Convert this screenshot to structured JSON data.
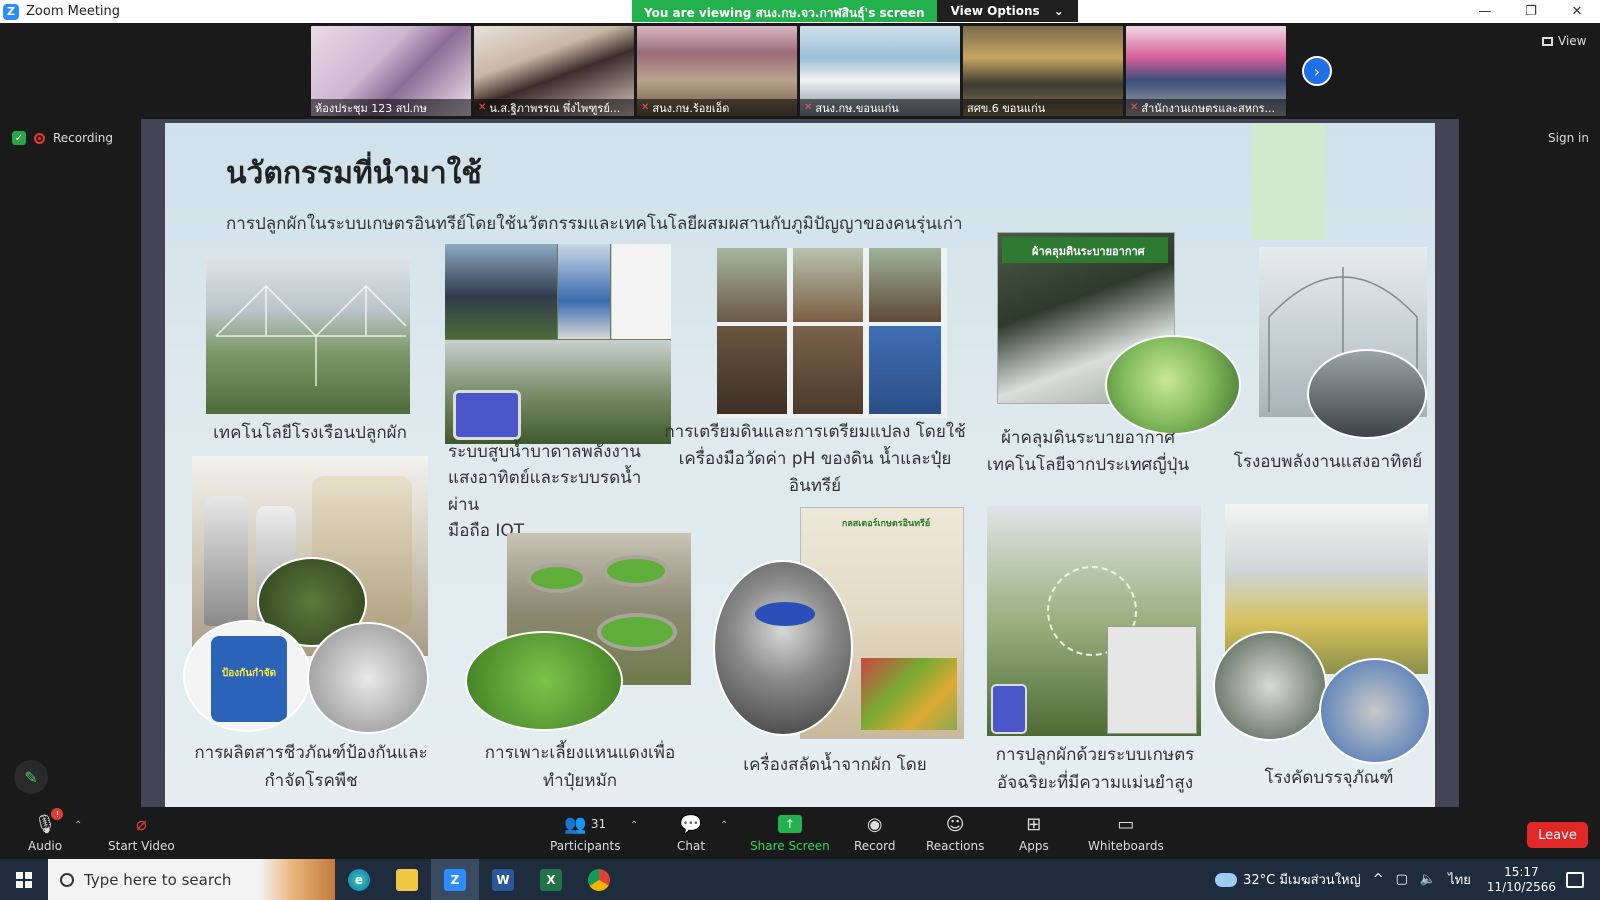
{
  "window": {
    "title": "Zoom Meeting",
    "minimize": "—",
    "restore": "❐",
    "close": "✕"
  },
  "banner": {
    "viewing_text": "You are viewing สนง.กษ.จว.กาฬสินธุ์'s screen",
    "view_options": "View Options",
    "caret": "⌄"
  },
  "participants": [
    {
      "name": "ห้องประชุม 123 สป.กษ",
      "muted": false
    },
    {
      "name": "น.ส.ฐิภาพรรณ พึ่งไพฑูรย์...",
      "muted": true
    },
    {
      "name": "สนง.กษ.ร้อยเอ็ด",
      "muted": true
    },
    {
      "name": "สนง.กษ.ขอนแก่น",
      "muted": true
    },
    {
      "name": "สศข.6 ขอนแก่น",
      "muted": false
    },
    {
      "name": "สำนักงานเกษตรและสหกร...",
      "muted": true
    }
  ],
  "next_arrow": "›",
  "view_button": "View",
  "recording_label": "Recording",
  "sign_in": "Sign in",
  "slide": {
    "title": "นวัตกรรมที่นำมาใช้",
    "subtitle": "การปลูกผักในระบบเกษตรอินทรีย์โดยใช้นวัตกรรมและเทคโนโลยีผสมผสานกับภูมิปัญญาของคนรุ่นเก่า",
    "captions": {
      "greenhouse": "เทคโนโลยีโรงเรือนปลูกผัก",
      "solar_pump": "ระบบสูบน้ำบาดาลพลังงาน\nแสงอาทิตย์และระบบรดน้ำผ่าน\nมือถือ IOT",
      "soil_prep": "การเตรียมดินและการเตรียมแปลง โดยใช้\nเครื่องมือวัดค่า pH ของดิน น้ำและปุ๋ยอินทรีย์",
      "mulch": "ผ้าคลุมดินระบายอากาศ\nเทคโนโลยีจากประเทศญี่ปุ่น",
      "solar_dryer": "โรงอบพลังงานแสงอาทิตย์",
      "biocontrol": "การผลิตสารชีวภัณฑ์ป้องกันและ\nกำจัดโรคพืช",
      "azolla": "การเพาะเลี้ยงแหนแดงเพื่อ\nทำปุ๋ยหมัก",
      "juicer": "เครื่องสลัดน้ำจากผัก โดย",
      "smart_farm": "การปลูกผักด้วยระบบเกษตร\nอัจฉริยะที่มีความแม่นยำสูง",
      "packing": "โรงคัดบรรจุภัณฑ์"
    },
    "mulch_label": "ผ้าคลุมดินระบายอากาศ",
    "biocontrol_jar_label": "ป้องกันกำจัด",
    "juicer_poster_label": "กลสเตอร์เกษตรอินทรีย์"
  },
  "toolbar": {
    "audio": "Audio",
    "audio_badge": "!",
    "start_video": "Start Video",
    "participants": "Participants",
    "participants_count": "31",
    "chat": "Chat",
    "share_screen": "Share Screen",
    "record": "Record",
    "reactions": "Reactions",
    "apps": "Apps",
    "whiteboards": "Whiteboards",
    "leave": "Leave",
    "caret_up": "⌃"
  },
  "taskbar": {
    "search_placeholder": "Type here to search",
    "weather": "32°C มีเมฆส่วนใหญ่",
    "language": "ไทย",
    "time": "15:17",
    "date": "11/10/2566",
    "tray_caret": "^"
  },
  "colors": {
    "accent_green": "#22b14c",
    "leave_red": "#e02828",
    "zoom_blue": "#2d8cff"
  }
}
